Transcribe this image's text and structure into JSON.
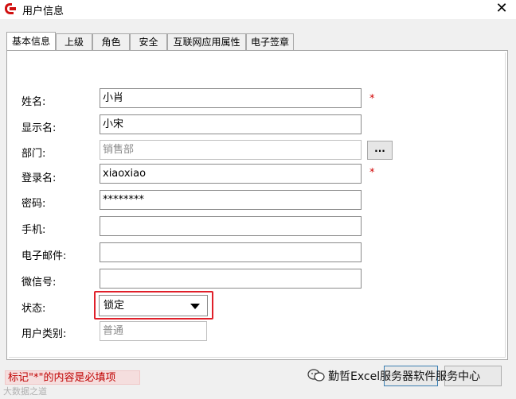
{
  "window": {
    "title": "用户信息"
  },
  "tabs": [
    {
      "label": "基本信息"
    },
    {
      "label": "上级"
    },
    {
      "label": "角色"
    },
    {
      "label": "安全"
    },
    {
      "label": "互联网应用属性"
    },
    {
      "label": "电子签章"
    }
  ],
  "form": {
    "name": {
      "label": "姓名:",
      "value": "小肖",
      "required": "*"
    },
    "display_name": {
      "label": "显示名:",
      "value": "小宋"
    },
    "department": {
      "label": "部门:",
      "value": "销售部",
      "browse_label": "..."
    },
    "login_name": {
      "label": "登录名:",
      "value": "xiaoxiao",
      "required": "*"
    },
    "password": {
      "label": "密码:",
      "value": "********"
    },
    "mobile": {
      "label": "手机:",
      "value": ""
    },
    "email": {
      "label": "电子邮件:",
      "value": ""
    },
    "wechat": {
      "label": "微信号:",
      "value": ""
    },
    "status": {
      "label": "状态:",
      "value": "锁定"
    },
    "user_type": {
      "label": "用户类别:",
      "value": "普通"
    }
  },
  "footer": {
    "notice": "标记\"*\"的内容是必填项"
  },
  "watermark": {
    "text": "勤哲Excel服务器软件服务中心",
    "bottom_text": "大数据之道"
  },
  "colors": {
    "highlight": "#e0202a",
    "required": "#d00000",
    "notice_bg": "#f5dede"
  }
}
